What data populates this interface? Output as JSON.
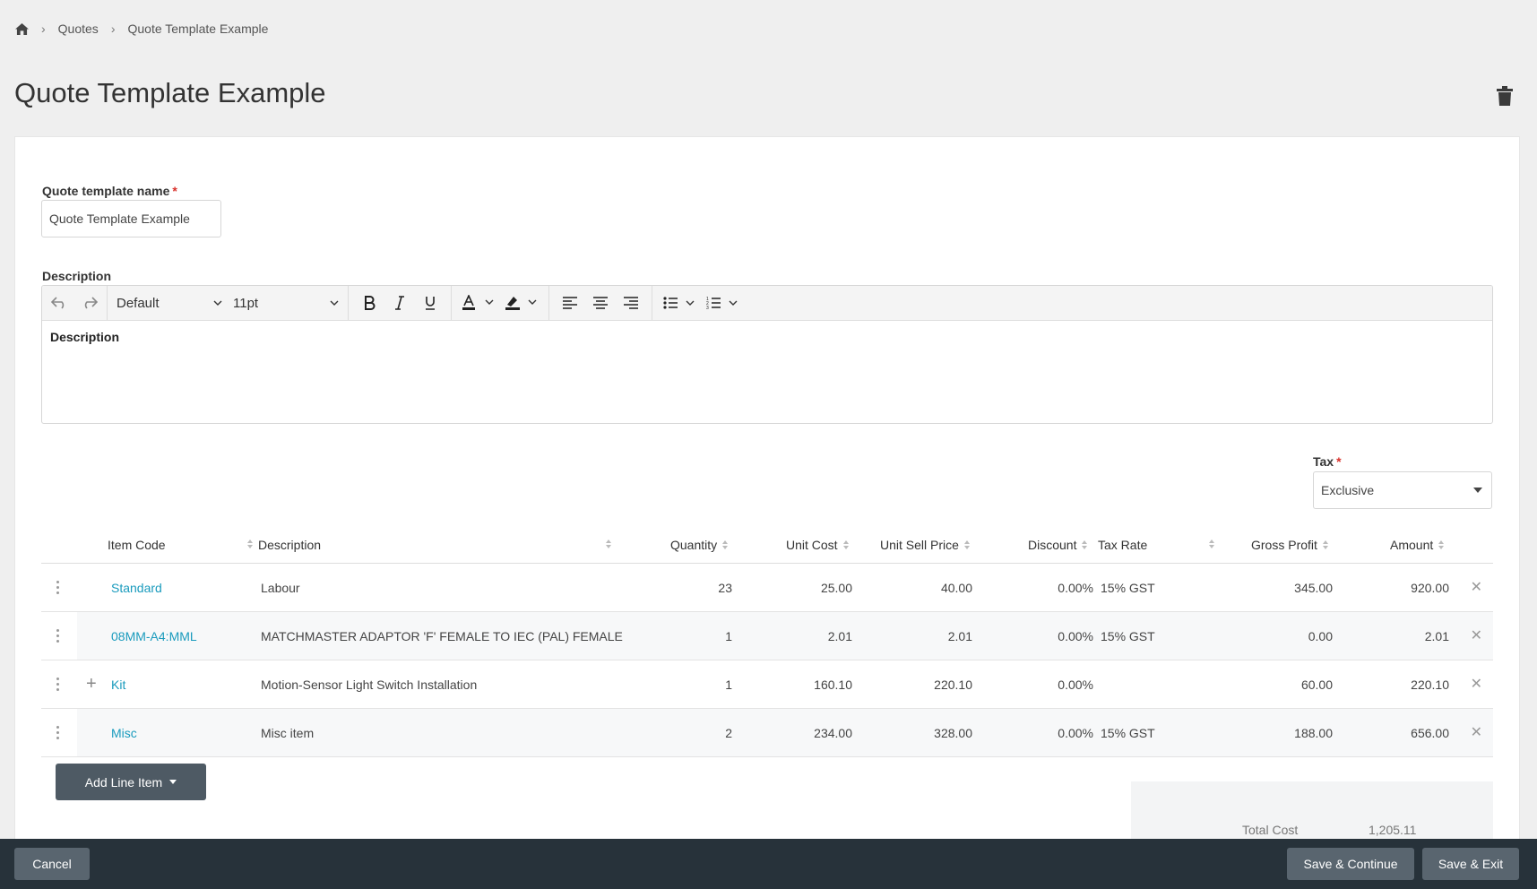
{
  "breadcrumb": {
    "items": [
      "Quotes",
      "Quote Template Example"
    ]
  },
  "page": {
    "title": "Quote Template Example"
  },
  "form": {
    "name_label": "Quote template name",
    "required_mark": "*",
    "name_value": "Quote Template Example",
    "description_label": "Description",
    "tax_label": "Tax",
    "tax_value": "Exclusive"
  },
  "editor": {
    "font_family": "Default",
    "font_size": "11pt",
    "content": "Description"
  },
  "table": {
    "headers": {
      "item_code": "Item Code",
      "description": "Description",
      "quantity": "Quantity",
      "unit_cost": "Unit Cost",
      "unit_sell_price": "Unit Sell Price",
      "discount": "Discount",
      "tax_rate": "Tax Rate",
      "gross_profit": "Gross Profit",
      "amount": "Amount"
    },
    "rows": [
      {
        "item_code": "Standard",
        "description": "Labour",
        "quantity": "23",
        "unit_cost": "25.00",
        "unit_sell_price": "40.00",
        "discount": "0.00%",
        "tax_rate": "15% GST",
        "gross_profit": "345.00",
        "amount": "920.00",
        "expandable": false
      },
      {
        "item_code": "08MM-A4:MML",
        "description": "MATCHMASTER ADAPTOR 'F' FEMALE TO IEC (PAL) FEMALE",
        "quantity": "1",
        "unit_cost": "2.01",
        "unit_sell_price": "2.01",
        "discount": "0.00%",
        "tax_rate": "15% GST",
        "gross_profit": "0.00",
        "amount": "2.01",
        "expandable": false
      },
      {
        "item_code": "Kit",
        "description": "Motion-Sensor Light Switch Installation",
        "quantity": "1",
        "unit_cost": "160.10",
        "unit_sell_price": "220.10",
        "discount": "0.00%",
        "tax_rate": "",
        "gross_profit": "60.00",
        "amount": "220.10",
        "expandable": true
      },
      {
        "item_code": "Misc",
        "description": "Misc item",
        "quantity": "2",
        "unit_cost": "234.00",
        "unit_sell_price": "328.00",
        "discount": "0.00%",
        "tax_rate": "15% GST",
        "gross_profit": "188.00",
        "amount": "656.00",
        "expandable": false
      }
    ]
  },
  "actions": {
    "add_line_item": "Add Line Item",
    "cancel": "Cancel",
    "save_continue": "Save & Continue",
    "save_exit": "Save & Exit"
  },
  "totals": {
    "total_cost_label": "Total Cost",
    "total_cost_value": "1,205.11"
  },
  "colors": {
    "link": "#1a9bbd",
    "footer": "#27323a",
    "button": "#4e5a64",
    "required": "#d9312b"
  }
}
